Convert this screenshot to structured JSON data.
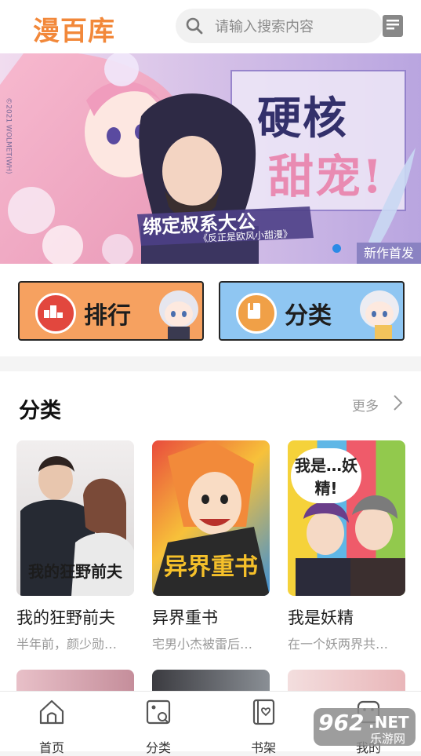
{
  "header": {
    "logo": "漫百库",
    "search_placeholder": "请输入搜索内容"
  },
  "banner": {
    "headline_1": "硬核",
    "headline_2": "甜宠!",
    "subtitle": "绑定叔系大公",
    "tagline": "《反正是欧风小甜漫》",
    "badge": "新作首发",
    "copyright": "©2021 WOLMET(WH)"
  },
  "quick": {
    "rank_label": "排行",
    "category_label": "分类"
  },
  "section": {
    "title": "分类",
    "more_label": "更多",
    "cards": [
      {
        "title": "我的狂野前夫",
        "desc": "半年前，颜少勋…",
        "cover_text": "我的狂野前夫"
      },
      {
        "title": "异界重书",
        "desc": "宅男小杰被雷后…",
        "cover_text": "异界重书"
      },
      {
        "title": "我是妖精",
        "desc": "在一个妖两界共…",
        "cover_text": "我是…妖精!"
      }
    ]
  },
  "tabbar": {
    "tabs": [
      {
        "label": "首页",
        "icon": "home-icon"
      },
      {
        "label": "分类",
        "icon": "category-icon"
      },
      {
        "label": "书架",
        "icon": "bookshelf-icon"
      },
      {
        "label": "我的",
        "icon": "profile-icon"
      }
    ]
  },
  "watermark": {
    "text_1": "962",
    "text_2": ".NET",
    "text_3": "乐游网"
  },
  "colors": {
    "accent": "#f2883a",
    "rank_bg": "#f6a160",
    "category_bg": "#8fc6f2"
  }
}
